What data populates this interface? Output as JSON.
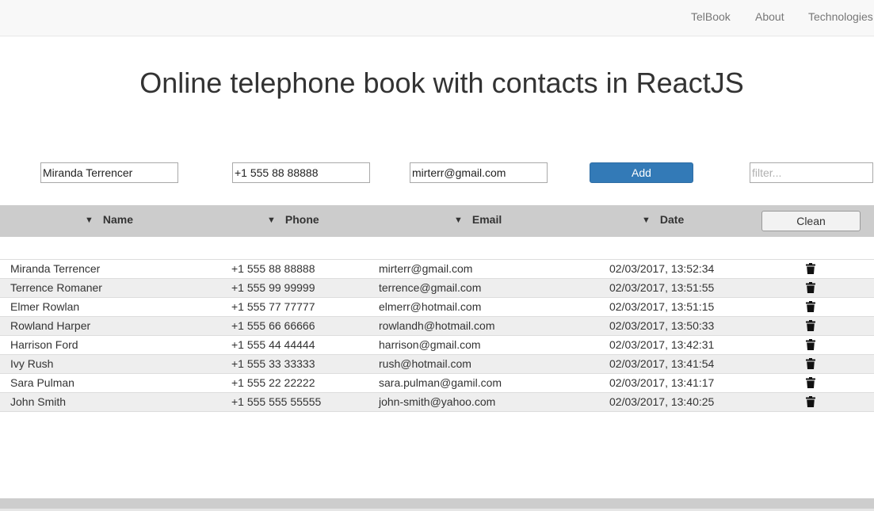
{
  "nav": {
    "items": [
      "TelBook",
      "About",
      "Technologies"
    ]
  },
  "title": "Online telephone book with contacts in ReactJS",
  "form": {
    "name_value": "Miranda Terrencer",
    "phone_value": "+1 555 88 88888",
    "email_value": "mirterr@gmail.com",
    "add_label": "Add",
    "filter_placeholder": "filter..."
  },
  "table": {
    "headers": {
      "name": "Name",
      "phone": "Phone",
      "email": "Email",
      "date": "Date"
    },
    "clean_label": "Clean",
    "rows": [
      {
        "name": "Miranda Terrencer",
        "phone": "+1 555 88 88888",
        "email": "mirterr@gmail.com",
        "date": "02/03/2017, 13:52:34"
      },
      {
        "name": "Terrence Romaner",
        "phone": "+1 555 99 99999",
        "email": "terrence@gmail.com",
        "date": "02/03/2017, 13:51:55"
      },
      {
        "name": "Elmer Rowlan",
        "phone": "+1 555 77 77777",
        "email": "elmerr@hotmail.com",
        "date": "02/03/2017, 13:51:15"
      },
      {
        "name": "Rowland Harper",
        "phone": "+1 555 66 66666",
        "email": "rowlandh@hotmail.com",
        "date": "02/03/2017, 13:50:33"
      },
      {
        "name": "Harrison Ford",
        "phone": "+1 555 44 44444",
        "email": "harrison@gmail.com",
        "date": "02/03/2017, 13:42:31"
      },
      {
        "name": "Ivy Rush",
        "phone": "+1 555 33 33333",
        "email": "rush@hotmail.com",
        "date": "02/03/2017, 13:41:54"
      },
      {
        "name": "Sara Pulman",
        "phone": "+1 555 22 22222",
        "email": "sara.pulman@gamil.com",
        "date": "02/03/2017, 13:41:17"
      },
      {
        "name": "John Smith",
        "phone": "+1 555 555 55555",
        "email": "john-smith@yahoo.com",
        "date": "02/03/2017, 13:40:25"
      }
    ]
  },
  "colors": {
    "primary_button": "#337ab7",
    "header_bar": "#cccccc",
    "striped_row": "#eeeeee",
    "navbar_bg": "#f8f8f8"
  }
}
